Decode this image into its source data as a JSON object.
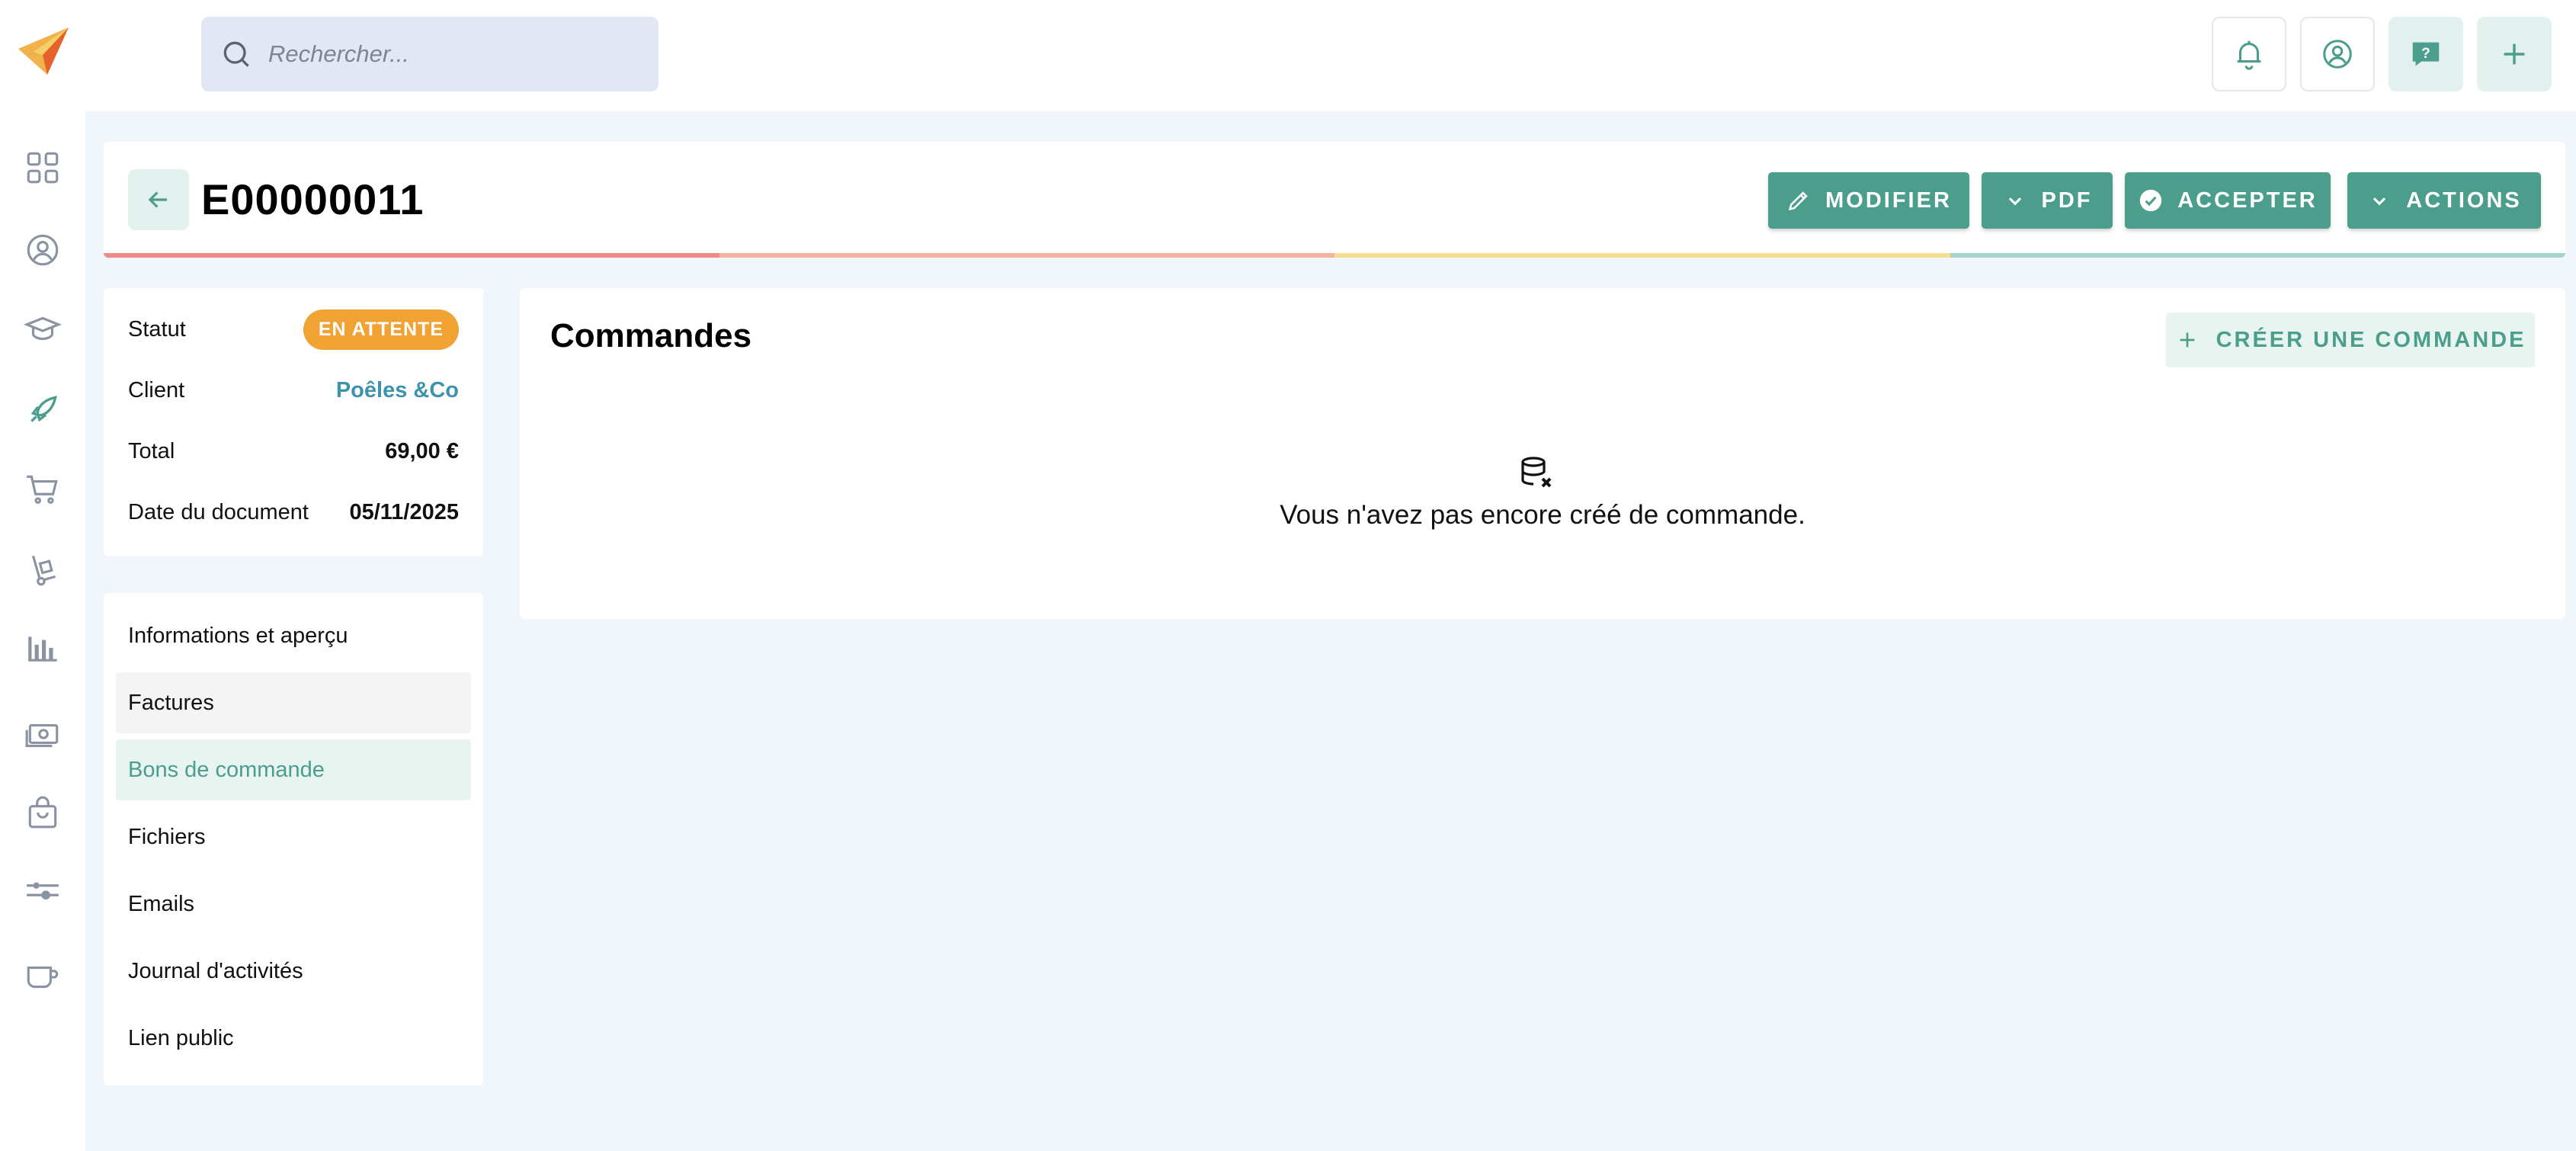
{
  "search": {
    "placeholder": "Rechercher..."
  },
  "document": {
    "number": "E00000011",
    "actions": {
      "modifier": "MODIFIER",
      "pdf": "PDF",
      "accepter": "ACCEPTER",
      "actions": "ACTIONS"
    },
    "progress_colors": [
      "#ef8a84",
      "#f6b3a2",
      "#f7dd8f",
      "#a8d3c9"
    ]
  },
  "summary": {
    "status_label": "Statut",
    "status_value": "EN ATTENTE",
    "client_label": "Client",
    "client_value": "Poêles &Co",
    "total_label": "Total",
    "total_value": "69,00 €",
    "date_label": "Date du document",
    "date_value": "05/11/2025"
  },
  "nav": {
    "items": [
      {
        "label": "Informations et aperçu"
      },
      {
        "label": "Factures"
      },
      {
        "label": "Bons de commande"
      },
      {
        "label": "Fichiers"
      },
      {
        "label": "Emails"
      },
      {
        "label": "Journal d'activités"
      },
      {
        "label": "Lien public"
      }
    ],
    "active_index": 2
  },
  "commandes": {
    "title": "Commandes",
    "create_label": "CRÉER UNE COMMANDE",
    "empty_message": "Vous n'avez pas encore créé de commande."
  },
  "icons": {
    "rail": [
      "dashboard-icon",
      "user-circle-icon",
      "graduation-cap-icon",
      "rocket-icon",
      "cart-icon",
      "hand-truck-icon",
      "bar-chart-icon",
      "money-icon",
      "shopping-bag-icon",
      "sliders-icon",
      "mug-icon"
    ],
    "top": [
      "bell-icon",
      "user-circle-icon",
      "help-chat-icon",
      "plus-icon"
    ]
  },
  "colors": {
    "accent": "#4b9d8c",
    "accent_light": "#e7f4f0",
    "badge_orange": "#f0a233",
    "link_blue": "#3d93ad"
  }
}
